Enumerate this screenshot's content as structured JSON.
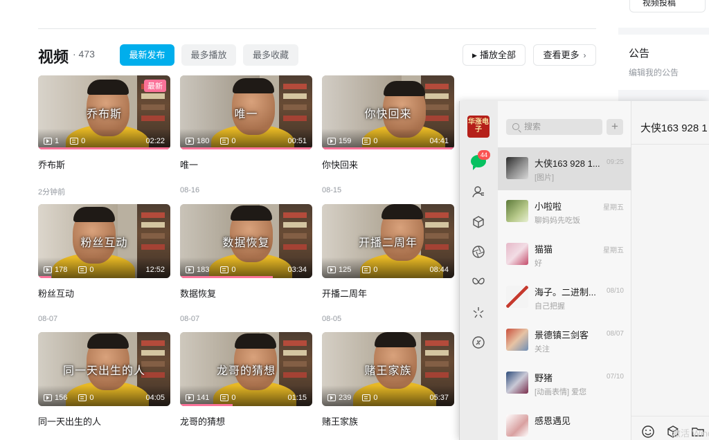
{
  "page": {
    "title": "视频",
    "count": "· 473",
    "sort_tabs": [
      "最新发布",
      "最多播放",
      "最多收藏"
    ],
    "play_all": "播放全部",
    "see_more": "查看更多"
  },
  "videos": [
    {
      "title": "乔布斯",
      "overlay": "乔布斯",
      "plays": "1",
      "danmaku": "0",
      "duration": "02:22",
      "date": "2分钟前",
      "badge": "最新",
      "progress": 1.0
    },
    {
      "title": "唯一",
      "overlay": "唯一",
      "plays": "180",
      "danmaku": "0",
      "duration": "00:51",
      "date": "08-16",
      "badge": "",
      "progress": 1.0
    },
    {
      "title": "你快回来",
      "overlay": "你快回来",
      "plays": "159",
      "danmaku": "0",
      "duration": "04:41",
      "date": "08-15",
      "badge": "",
      "progress": 1.0
    },
    {
      "title": "粉丝互动",
      "overlay": "粉丝互动",
      "plays": "178",
      "danmaku": "0",
      "duration": "12:52",
      "date": "08-07",
      "badge": "",
      "progress": 0.1
    },
    {
      "title": "数据恢复",
      "overlay": "数据恢复",
      "plays": "183",
      "danmaku": "0",
      "duration": "03:34",
      "date": "08-07",
      "badge": "",
      "progress": 0.7
    },
    {
      "title": "开播二周年",
      "overlay": "开播二周年",
      "plays": "125",
      "danmaku": "0",
      "duration": "08:44",
      "date": "08-05",
      "badge": "",
      "progress": 0
    },
    {
      "title": "同一天出生的人",
      "overlay": "同一天出生的人",
      "plays": "156",
      "danmaku": "0",
      "duration": "04:05",
      "date": "",
      "badge": "",
      "progress": 0
    },
    {
      "title": "龙哥的猜想",
      "overlay": "龙哥的猜想",
      "plays": "141",
      "danmaku": "0",
      "duration": "01:15",
      "date": "",
      "badge": "",
      "progress": 0.4
    },
    {
      "title": "赌王家族",
      "overlay": "赌王家族",
      "plays": "239",
      "danmaku": "0",
      "duration": "05:37",
      "date": "",
      "badge": "",
      "progress": 0
    }
  ],
  "right_column": {
    "submit_button": "视频投稿",
    "notice_title": "公告",
    "notice_edit": "编辑我的公告"
  },
  "wechat": {
    "avatar_text": "华涨电子",
    "unread_badge": "44",
    "search_placeholder": "搜索",
    "chat_title": "大侠163 928 1",
    "watermark": "激活 Windows",
    "conversations": [
      {
        "name": "大侠163 928 1...",
        "time": "09:25",
        "msg": "[图片]"
      },
      {
        "name": "小啦啦",
        "time": "星期五",
        "msg": "聊妈妈先吃饭"
      },
      {
        "name": "猫猫",
        "time": "星期五",
        "msg": "好"
      },
      {
        "name": "海子。二进制...",
        "time": "08/10",
        "msg": "自己把握"
      },
      {
        "name": "景德镇三剑客",
        "time": "08/07",
        "msg": "关注"
      },
      {
        "name": "野猪",
        "time": "07/10",
        "msg": "[动画表情] 爱您"
      },
      {
        "name": "感恩遇见",
        "time": "",
        "msg": ""
      }
    ]
  },
  "colors": {
    "accent": "#00aeec",
    "pink": "#fb7299",
    "wechat_green": "#07c160",
    "badge_red": "#fa5151"
  },
  "icons": [
    "play-icon",
    "danmaku-icon",
    "search-icon",
    "plus-icon",
    "chat-icon",
    "contacts-icon",
    "box-icon",
    "aperture-icon",
    "butterfly-icon",
    "sparkle-icon",
    "link-icon",
    "emoji-icon",
    "folder-icon",
    "upload-icon"
  ]
}
